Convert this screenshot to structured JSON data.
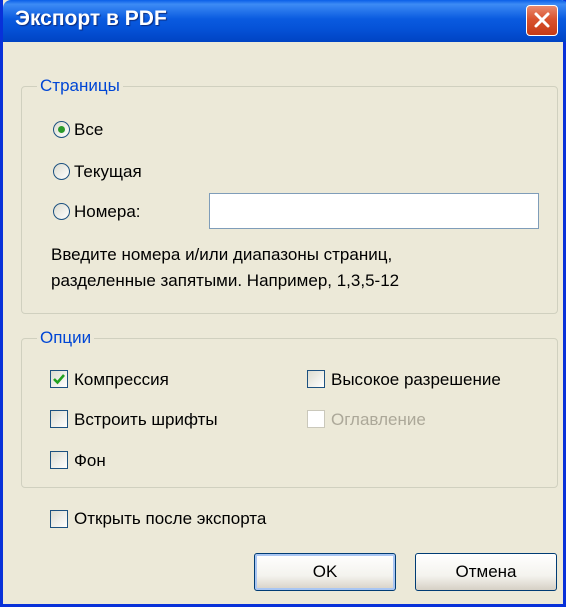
{
  "window": {
    "title": "Экспорт в PDF"
  },
  "pages_group": {
    "legend": "Страницы",
    "radio_all": "Все",
    "radio_current": "Текущая",
    "radio_numbers": "Номера:",
    "numbers_value": "",
    "selected": "all",
    "hint_line1": "Введите номера и/или диапазоны страниц,",
    "hint_line2": "разделенные запятыми. Например, 1,3,5-12"
  },
  "options_group": {
    "legend": "Опции",
    "compression": {
      "label": "Компрессия",
      "checked": true
    },
    "high_resolution": {
      "label": "Высокое разрешение",
      "checked": false
    },
    "embed_fonts": {
      "label": "Встроить шрифты",
      "checked": false
    },
    "table_of_contents": {
      "label": "Оглавление",
      "checked": false,
      "disabled": true
    },
    "background": {
      "label": "Фон",
      "checked": false
    }
  },
  "open_after_export": {
    "label": "Открыть после экспорта",
    "checked": false
  },
  "buttons": {
    "ok": "OK",
    "cancel": "Отмена"
  },
  "colors": {
    "title_bar": "#0A5BE0",
    "legend_text": "#0046D5",
    "check_mark": "#21A121",
    "dialog_bg": "#ECE9D8"
  }
}
